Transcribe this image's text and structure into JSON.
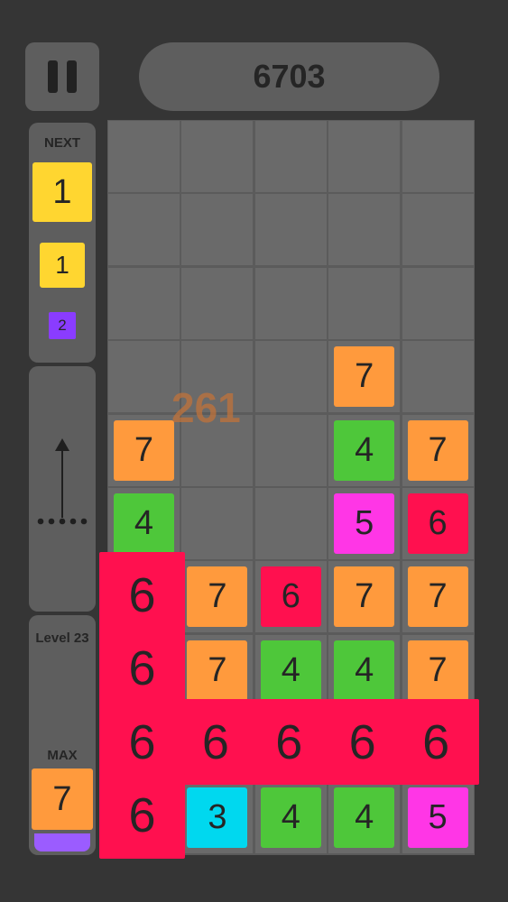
{
  "score": "6703",
  "bonus_score": "261",
  "next": {
    "label": "NEXT",
    "tiles": [
      {
        "value": "1",
        "color": "#ffd630"
      },
      {
        "value": "1",
        "color": "#ffd630"
      },
      {
        "value": "2",
        "color": "#8a3cff"
      }
    ]
  },
  "level": {
    "label": "Level 23",
    "max_label": "MAX",
    "max_value": "7",
    "max_color": "#ff9a3d",
    "max_underbar_color": "#9b5cff"
  },
  "icons": {
    "pause": "pause-icon",
    "drop": "up-arrow-icon",
    "drop_dots": "dots-icon"
  },
  "colors": {
    "1": "#ffd630",
    "2": "#8a3cff",
    "3": "#00d8ef",
    "4": "#4ec73a",
    "5": "#ff36e6",
    "6": "#ff104f",
    "7": "#ff9a3d"
  },
  "board": {
    "columns": 5,
    "rows": 10,
    "cells": [
      [
        "",
        "",
        "",
        "",
        ""
      ],
      [
        "",
        "",
        "",
        "",
        ""
      ],
      [
        "",
        "",
        "",
        "",
        ""
      ],
      [
        "",
        "",
        "",
        "7",
        ""
      ],
      [
        "7",
        "",
        "",
        "4",
        "7"
      ],
      [
        "4",
        "",
        "",
        "5",
        "6"
      ],
      [
        "6",
        "7",
        "6",
        "7",
        "7"
      ],
      [
        "6",
        "7",
        "4",
        "4",
        "7"
      ],
      [
        "6",
        "6",
        "6",
        "6",
        "6"
      ],
      [
        "6",
        "3",
        "4",
        "4",
        "5"
      ]
    ]
  }
}
